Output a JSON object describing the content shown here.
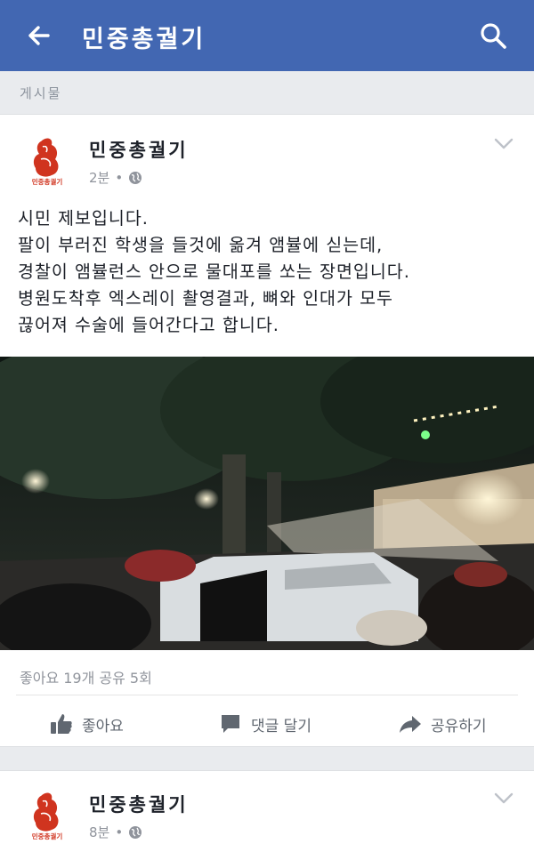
{
  "header": {
    "title": "민중총궐기",
    "back_icon": "arrow-left-icon",
    "search_icon": "search-icon",
    "bg_color": "#4267b2"
  },
  "section_label": "게시물",
  "posts": [
    {
      "page_name": "민중총궐기",
      "logo_text": "민중총궐기",
      "time": "2분",
      "privacy_icon": "globe-icon",
      "text_lines": [
        "시민 제보입니다.",
        "팔이 부러진 학생을 들것에 옮겨 앰뷸에 싣는데,",
        "경찰이 앰뷸런스 안으로 물대포를 쏘는 장면입니다.",
        "병원도착후 엑스레이 촬영결과, 뼈와 인대가 모두",
        "끊어져 수술에 들어간다고 합니다."
      ],
      "stats": "좋아요 19개  공유 5회",
      "actions": {
        "like": "좋아요",
        "comment": "댓글 달기",
        "share": "공유하기"
      }
    },
    {
      "page_name": "민중총궐기",
      "logo_text": "민중총궐기",
      "time": "8분",
      "privacy_icon": "globe-icon"
    }
  ]
}
